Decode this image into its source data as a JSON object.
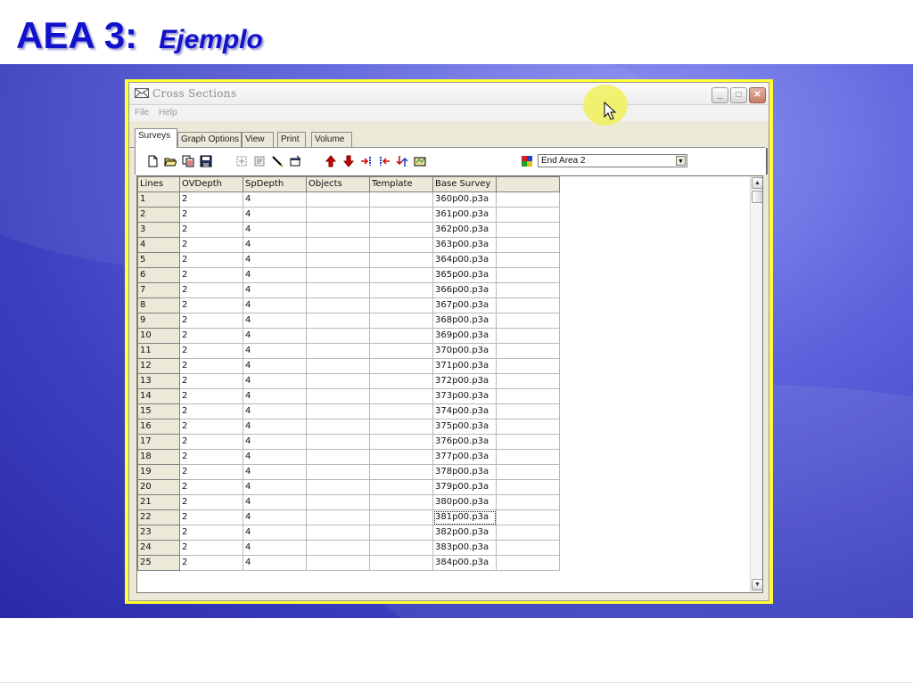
{
  "slide": {
    "title": "AEA 3:",
    "subtitle": "Ejemplo"
  },
  "window": {
    "title": "Cross  Sections",
    "menu": [
      "File",
      "Help"
    ],
    "tabs": [
      "Surveys",
      "Graph Options",
      "View",
      "Print",
      "Volume"
    ],
    "active_tab": "Surveys",
    "combo_value": "End Area 2"
  },
  "grid": {
    "columns": [
      "Lines",
      "OVDepth",
      "SpDepth",
      "Objects",
      "Template",
      "Base Survey",
      ""
    ],
    "rows": [
      [
        "1",
        "2",
        "4",
        "",
        "",
        "360p00.p3a",
        ""
      ],
      [
        "2",
        "2",
        "4",
        "",
        "",
        "361p00.p3a",
        ""
      ],
      [
        "3",
        "2",
        "4",
        "",
        "",
        "362p00.p3a",
        ""
      ],
      [
        "4",
        "2",
        "4",
        "",
        "",
        "363p00.p3a",
        ""
      ],
      [
        "5",
        "2",
        "4",
        "",
        "",
        "364p00.p3a",
        ""
      ],
      [
        "6",
        "2",
        "4",
        "",
        "",
        "365p00.p3a",
        ""
      ],
      [
        "7",
        "2",
        "4",
        "",
        "",
        "366p00.p3a",
        ""
      ],
      [
        "8",
        "2",
        "4",
        "",
        "",
        "367p00.p3a",
        ""
      ],
      [
        "9",
        "2",
        "4",
        "",
        "",
        "368p00.p3a",
        ""
      ],
      [
        "10",
        "2",
        "4",
        "",
        "",
        "369p00.p3a",
        ""
      ],
      [
        "11",
        "2",
        "4",
        "",
        "",
        "370p00.p3a",
        ""
      ],
      [
        "12",
        "2",
        "4",
        "",
        "",
        "371p00.p3a",
        ""
      ],
      [
        "13",
        "2",
        "4",
        "",
        "",
        "372p00.p3a",
        ""
      ],
      [
        "14",
        "2",
        "4",
        "",
        "",
        "373p00.p3a",
        ""
      ],
      [
        "15",
        "2",
        "4",
        "",
        "",
        "374p00.p3a",
        ""
      ],
      [
        "16",
        "2",
        "4",
        "",
        "",
        "375p00.p3a",
        ""
      ],
      [
        "17",
        "2",
        "4",
        "",
        "",
        "376p00.p3a",
        ""
      ],
      [
        "18",
        "2",
        "4",
        "",
        "",
        "377p00.p3a",
        ""
      ],
      [
        "19",
        "2",
        "4",
        "",
        "",
        "378p00.p3a",
        ""
      ],
      [
        "20",
        "2",
        "4",
        "",
        "",
        "379p00.p3a",
        ""
      ],
      [
        "21",
        "2",
        "4",
        "",
        "",
        "380p00.p3a",
        ""
      ],
      [
        "22",
        "2",
        "4",
        "",
        "",
        "381p00.p3a",
        ""
      ],
      [
        "23",
        "2",
        "4",
        "",
        "",
        "382p00.p3a",
        ""
      ],
      [
        "24",
        "2",
        "4",
        "",
        "",
        "383p00.p3a",
        ""
      ],
      [
        "25",
        "2",
        "4",
        "",
        "",
        "384p00.p3a",
        ""
      ]
    ],
    "selected_cell": "381p00.p3a"
  },
  "colors": {
    "title": "#1212cc",
    "highlight_frame": "#ffff33",
    "background": "#4a4fcf"
  }
}
